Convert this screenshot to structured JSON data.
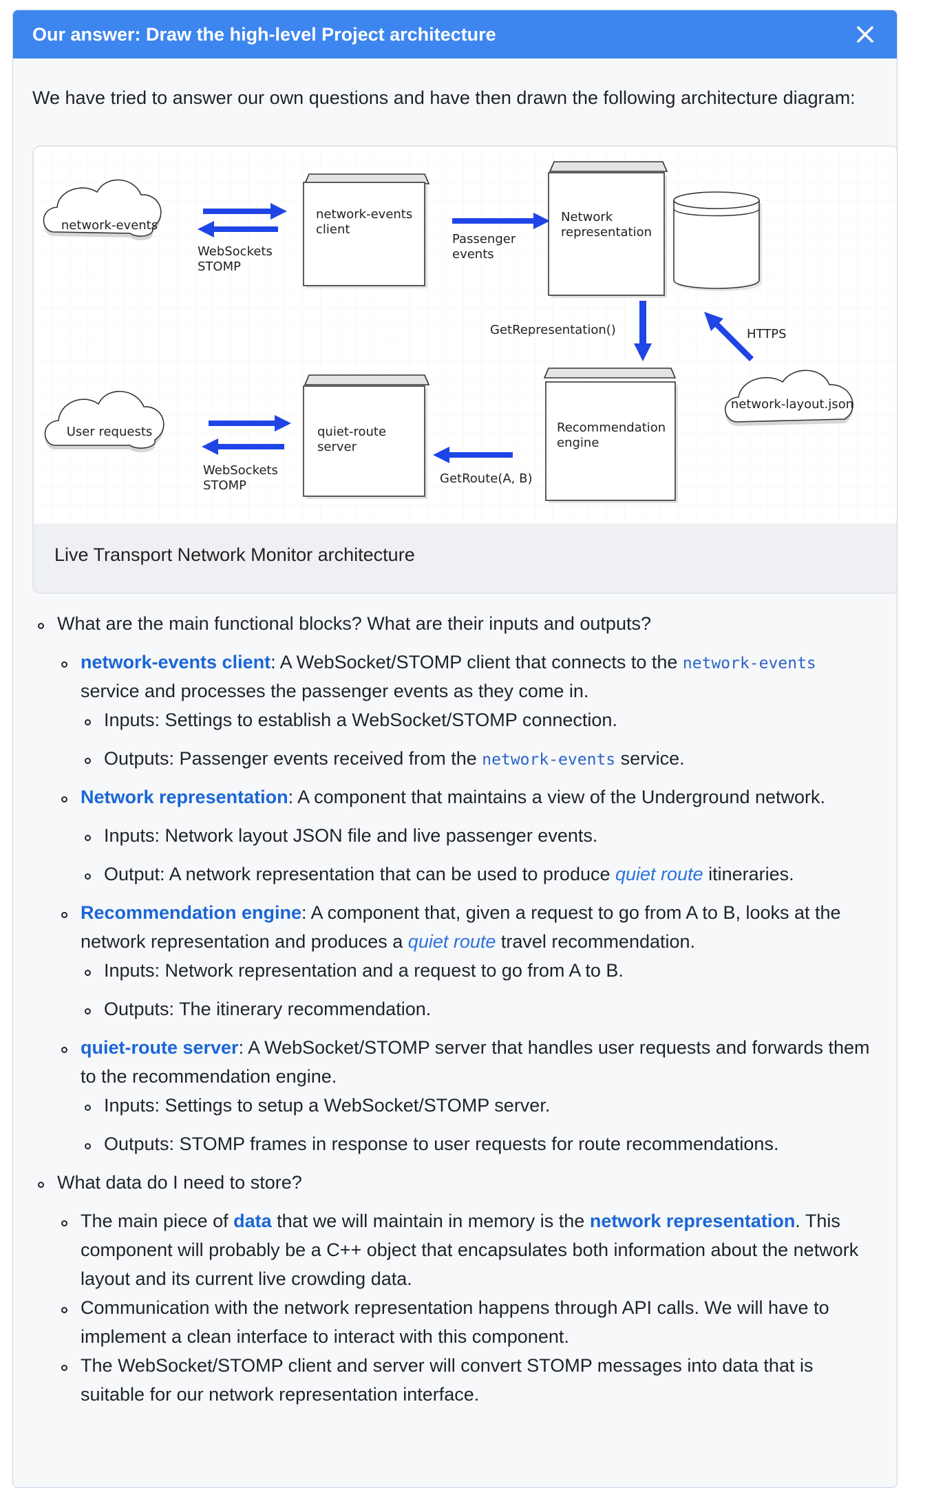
{
  "header": {
    "title": "Our answer: Draw the high-level Project architecture"
  },
  "intro": "We have tried to answer our own questions and have then drawn the following architecture diagram:",
  "diagram": {
    "caption": "Live Transport Network Monitor architecture",
    "cloud_network_events": "network-events",
    "cloud_user_requests": "User requests",
    "cloud_network_layout": "network-layout.json",
    "ws1_line1": "WebSockets",
    "ws1_line2": "STOMP",
    "ws2_line1": "WebSockets",
    "ws2_line2": "STOMP",
    "box_client_line1": "network-events",
    "box_client_line2": "client",
    "box_netrep_line1": "Network",
    "box_netrep_line2": "representation",
    "box_server_line1": "quiet-route",
    "box_server_line2": "server",
    "box_engine_line1": "Recommendation",
    "box_engine_line2": "engine",
    "passenger_line1": "Passenger",
    "passenger_line2": "events",
    "get_representation": "GetRepresentation()",
    "https": "HTTPS",
    "get_route": "GetRoute(A, B)"
  },
  "q1": {
    "text": "What are the main functional blocks? What are their inputs and outputs?"
  },
  "b1": {
    "kw": "network-events client",
    "t1": ": A WebSocket/STOMP client that connects to the ",
    "code": "network-events",
    "t2": "service and processes the passenger events as they come in.",
    "in": "Inputs: Settings to establish a WebSocket/STOMP connection.",
    "out_a": "Outputs: Passenger events received from the ",
    "out_code": "network-events",
    "out_b": " service."
  },
  "b2": {
    "kw": "Network representation",
    "t1": ": A component that maintains a view of the Underground network.",
    "in": "Inputs: Network layout JSON file and live passenger events.",
    "out_a": "Output: A network representation that can be used to produce ",
    "out_ital": "quiet route",
    "out_b": " itineraries."
  },
  "b3": {
    "kw": "Recommendation engine",
    "t1": ": A component that, given a request to go from A to B, looks at the",
    "t2a": "network representation and produces a ",
    "t2_ital": "quiet route",
    "t2b": " travel recommendation.",
    "in": "Inputs: Network representation and a request to go from A to B.",
    "out": "Outputs: The itinerary recommendation."
  },
  "b4": {
    "kw": "quiet-route server",
    "t1": ": A WebSocket/STOMP server that handles user requests and forwards them",
    "t2": "to the recommendation engine.",
    "in": "Inputs: Settings to setup a WebSocket/STOMP server.",
    "out": "Outputs: STOMP frames in response to user requests for route recommendations."
  },
  "q2": {
    "text": "What data do I need to store?"
  },
  "d1": {
    "a": "The main piece of ",
    "kw1": "data",
    "b": " that we will maintain in memory is the ",
    "kw2": "network representation",
    "c": ". This",
    "l2": "component will probably be a C++ object that encapsulates both information about the network",
    "l3": "layout and its current live crowding data."
  },
  "d2": {
    "l1": "Communication with the network representation happens through API calls. We will have to",
    "l2": "implement a clean interface to interact with this component."
  },
  "d3": {
    "l1": "The WebSocket/STOMP client and server will convert STOMP messages into data that is",
    "l2": "suitable for our network representation interface."
  }
}
